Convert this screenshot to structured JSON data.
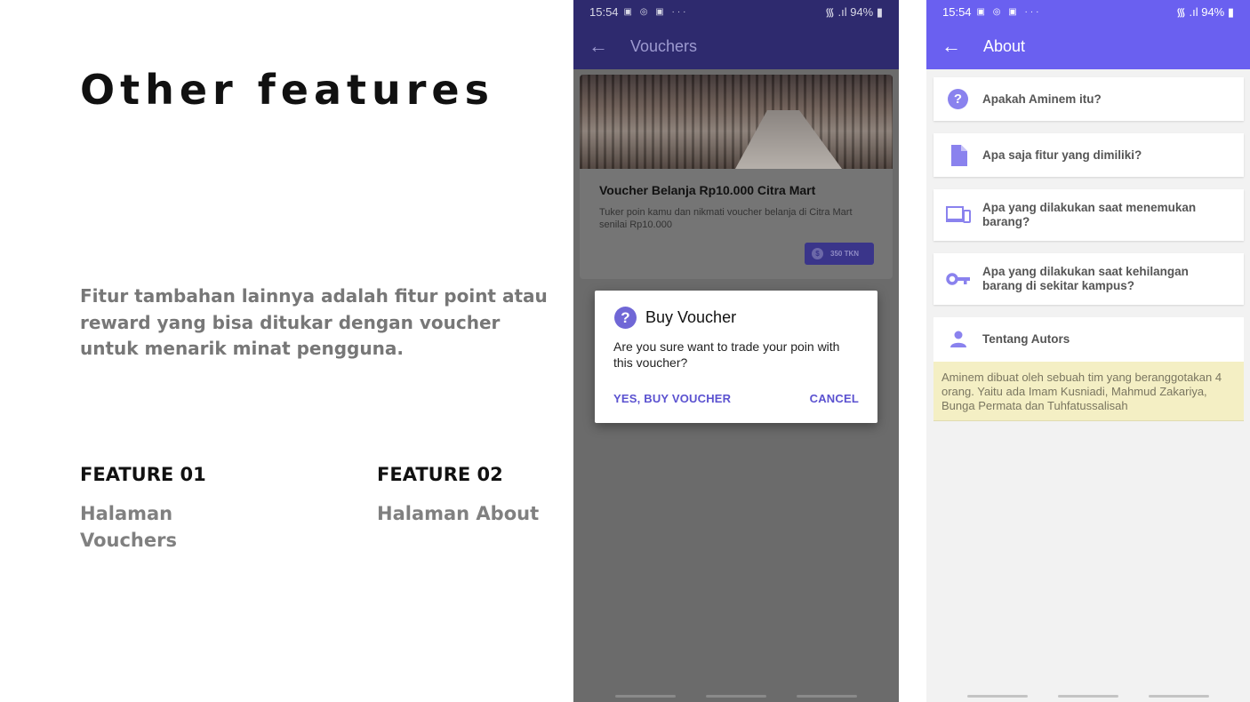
{
  "slide": {
    "title": "Other features",
    "description": "Fitur tambahan lainnya adalah fitur point atau reward yang bisa ditukar dengan voucher untuk menarik minat pengguna.",
    "features": [
      {
        "label": "FEATURE 01",
        "value": "Halaman Vouchers"
      },
      {
        "label": "FEATURE 02",
        "value": "Halaman About"
      }
    ]
  },
  "phone_vouchers": {
    "status": {
      "time": "15:54",
      "icons": "▣ ◎ ▣ ···",
      "right": "᯾ .ıl 94% ▮"
    },
    "app_bar": {
      "back_icon": "arrow-left-icon",
      "title": "Vouchers"
    },
    "card": {
      "title": "Voucher Belanja Rp10.000 Citra Mart",
      "description": "Tuker poin kamu dan nikmati voucher belanja di Citra Mart senilai Rp10.000",
      "token": "350 TKN"
    },
    "dialog": {
      "icon": "question-icon",
      "title": "Buy Voucher",
      "message": "Are you sure want to trade your poin with this voucher?",
      "confirm_label": "YES, BUY VOUCHER",
      "cancel_label": "CANCEL"
    }
  },
  "phone_about": {
    "status": {
      "time": "15:54",
      "icons": "▣ ◎ ▣ ···",
      "right": "᯾ .ıl 94% ▮"
    },
    "app_bar": {
      "back_icon": "arrow-left-icon",
      "title": "About"
    },
    "items": [
      {
        "icon": "question-icon",
        "label": "Apakah Aminem itu?"
      },
      {
        "icon": "document-icon",
        "label": "Apa saja fitur yang dimiliki?"
      },
      {
        "icon": "devices-icon",
        "label": "Apa yang dilakukan saat menemukan barang?"
      },
      {
        "icon": "key-icon",
        "label": "Apa yang dilakukan saat kehilangan barang di sekitar kampus?"
      },
      {
        "icon": "person-icon",
        "label": "Tentang Autors"
      }
    ],
    "author_note": "Aminem dibuat oleh sebuah tim yang beranggotakan 4 orang. Yaitu ada Imam Kusniadi, Mahmud Zakariya, Bunga Permata dan Tuhfatussalisah"
  },
  "colors": {
    "about_primary": "#6a60f0",
    "vouchers_primary_dimmed": "#2e2a6e",
    "dialog_button": "#5b52d0",
    "note_background": "#f4efc4"
  }
}
